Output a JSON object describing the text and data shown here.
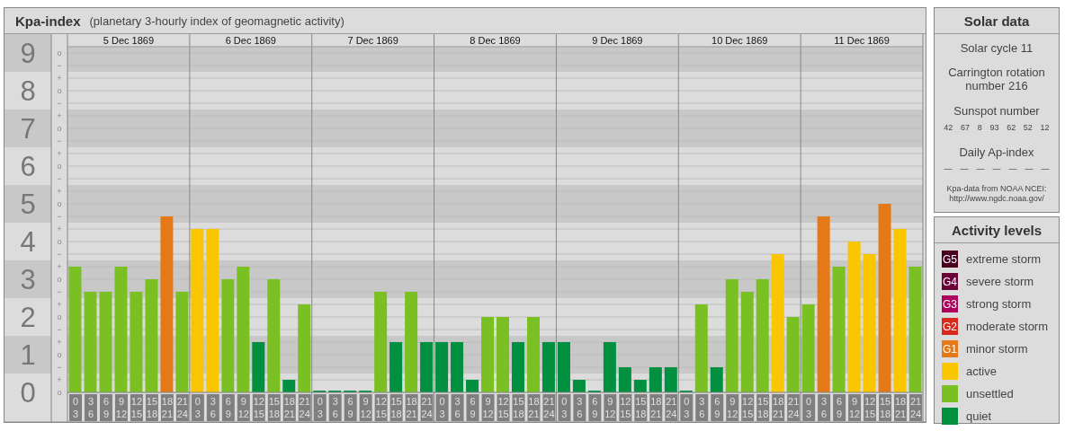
{
  "header": {
    "title": "Kpa-index",
    "subtitle": "(planetary 3-hourly index of geomagnetic activity)"
  },
  "chart": {
    "days": [
      "5 Dec 1869",
      "6 Dec 1869",
      "7 Dec 1869",
      "8 Dec 1869",
      "9 Dec 1869",
      "10 Dec 1869",
      "11 Dec 1869"
    ],
    "sub_labels": [
      "o",
      "−",
      "+",
      "o",
      "−",
      "+",
      "o",
      "−",
      "+",
      "o",
      "−",
      "+",
      "o",
      "−",
      "+",
      "o",
      "−",
      "+",
      "o",
      "−",
      "+",
      "o",
      "−",
      "+",
      "o",
      "−",
      "+",
      "o"
    ],
    "chart_data": {
      "type": "bar",
      "grid": true,
      "ylim": [
        0,
        9
      ],
      "yticks": [
        {
          "value": 0,
          "label": "0"
        },
        {
          "value": 1,
          "label": "1"
        },
        {
          "value": 2,
          "label": "2"
        },
        {
          "value": 3,
          "label": "3"
        },
        {
          "value": 4,
          "label": "4"
        },
        {
          "value": 5,
          "label": "5"
        },
        {
          "value": 6,
          "label": "6"
        },
        {
          "value": 7,
          "label": "7"
        },
        {
          "value": 8,
          "label": "8"
        },
        {
          "value": 9,
          "label": "9"
        }
      ],
      "categories": [
        "0\n3",
        "3\n6",
        "6\n9",
        "9\n12",
        "12\n15",
        "15\n18",
        "18\n21",
        "21\n24",
        "0\n3",
        "3\n6",
        "6\n9",
        "9\n12",
        "12\n15",
        "15\n18",
        "18\n21",
        "21\n24",
        "0\n3",
        "3\n6",
        "6\n9",
        "9\n12",
        "12\n15",
        "15\n18",
        "18\n21",
        "21\n24",
        "0\n3",
        "3\n6",
        "6\n9",
        "9\n12",
        "12\n15",
        "15\n18",
        "18\n21",
        "21\n24",
        "0\n3",
        "3\n6",
        "6\n9",
        "9\n12",
        "12\n15",
        "15\n18",
        "18\n21",
        "21\n24",
        "0\n3",
        "3\n6",
        "6\n9",
        "9\n12",
        "12\n15",
        "15\n18",
        "18\n21",
        "21\n24",
        "0\n3",
        "3\n6",
        "6\n9",
        "9\n12",
        "12\n15",
        "15\n18",
        "18\n21",
        "21\n24"
      ],
      "series": [
        {
          "color": "#00903f",
          "values": [
            null,
            null,
            null,
            null,
            null,
            null,
            null,
            null,
            null,
            null,
            null,
            null,
            1.33,
            null,
            0.33,
            null,
            0,
            0,
            0,
            0,
            null,
            1.33,
            null,
            1.33,
            1.33,
            1.33,
            0.33,
            null,
            null,
            1.33,
            null,
            1.33,
            1.33,
            0.33,
            0,
            1.33,
            0.67,
            0.33,
            0.67,
            0.67,
            0,
            null,
            0.67,
            null,
            null,
            null,
            null,
            null,
            null,
            null,
            null,
            null,
            null,
            null,
            null,
            null
          ]
        },
        {
          "color": "#7bc023",
          "values": [
            3.33,
            2.67,
            2.67,
            3.33,
            2.67,
            3,
            null,
            2.67,
            null,
            null,
            3,
            3.33,
            null,
            3,
            null,
            2.33,
            null,
            null,
            null,
            null,
            2.67,
            null,
            2.67,
            null,
            null,
            null,
            null,
            2,
            2,
            null,
            2,
            null,
            null,
            null,
            null,
            null,
            null,
            null,
            null,
            null,
            null,
            2.33,
            null,
            3,
            2.67,
            3,
            null,
            2,
            2.33,
            null,
            3.33,
            null,
            null,
            null,
            null,
            3.33
          ]
        },
        {
          "color": "#f9c600",
          "values": [
            null,
            null,
            null,
            null,
            null,
            null,
            null,
            null,
            4.33,
            4.33,
            null,
            null,
            null,
            null,
            null,
            null,
            null,
            null,
            null,
            null,
            null,
            null,
            null,
            null,
            null,
            null,
            null,
            null,
            null,
            null,
            null,
            null,
            null,
            null,
            null,
            null,
            null,
            null,
            null,
            null,
            null,
            null,
            null,
            null,
            null,
            null,
            3.67,
            null,
            null,
            null,
            null,
            4,
            3.67,
            null,
            4.33,
            null
          ]
        },
        {
          "color": "#e57817",
          "values": [
            null,
            null,
            null,
            null,
            null,
            null,
            4.67,
            null,
            null,
            null,
            null,
            null,
            null,
            null,
            null,
            null,
            null,
            null,
            null,
            null,
            null,
            null,
            null,
            null,
            null,
            null,
            null,
            null,
            null,
            null,
            null,
            null,
            null,
            null,
            null,
            null,
            null,
            null,
            null,
            null,
            null,
            null,
            null,
            null,
            null,
            null,
            null,
            null,
            null,
            4.67,
            null,
            null,
            null,
            5,
            null,
            null
          ]
        }
      ]
    }
  },
  "solar_data": {
    "title": "Solar data",
    "solar_cycle": "Solar cycle 11",
    "carrington": "Carrington rotation number 216",
    "sunspot_title": "Sunspot number",
    "sunspots": [
      "42",
      "67",
      "8",
      "93",
      "62",
      "52",
      "12"
    ],
    "ap_title": "Daily Ap-index",
    "ap_values": [
      "—",
      "—",
      "—",
      "—",
      "—",
      "—",
      "—"
    ],
    "source": "Kpa-data from NOAA NCEI:\nhttp://www.ngdc.noaa.gov/"
  },
  "legend": {
    "title": "Activity levels",
    "items": [
      {
        "badge": "G5",
        "label": "extreme storm",
        "color": "#4a0020"
      },
      {
        "badge": "G4",
        "label": "severe storm",
        "color": "#6c0038"
      },
      {
        "badge": "G3",
        "label": "strong storm",
        "color": "#b0005e"
      },
      {
        "badge": "G2",
        "label": "moderate storm",
        "color": "#d9281c"
      },
      {
        "badge": "G1",
        "label": "minor storm",
        "color": "#e57817"
      },
      {
        "label": "active",
        "color": "#f9c600"
      },
      {
        "label": "unsettled",
        "color": "#7bc023"
      },
      {
        "label": "quiet",
        "color": "#00903f"
      }
    ]
  }
}
